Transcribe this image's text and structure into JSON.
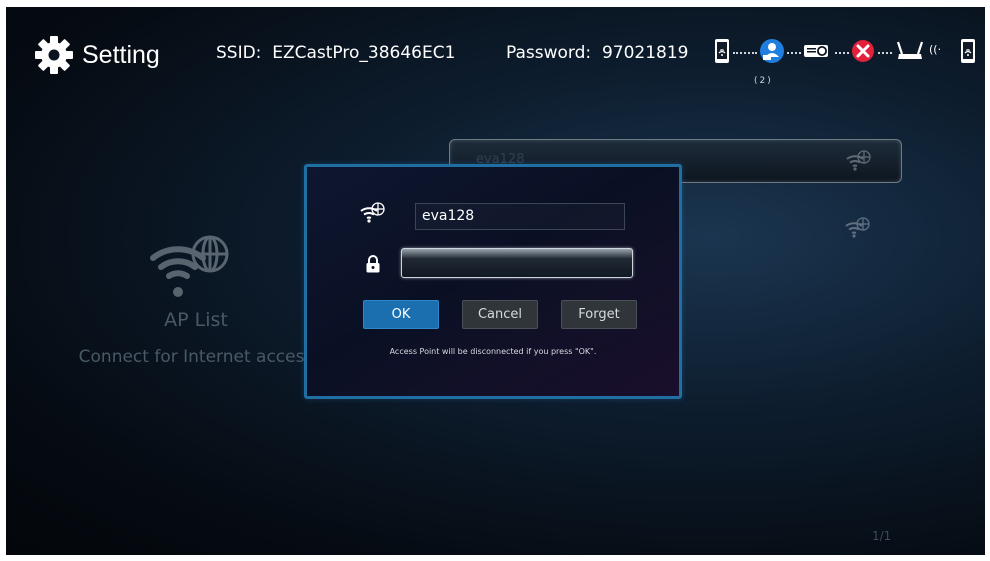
{
  "header": {
    "title": "Setting",
    "ssid_label": "SSID:",
    "ssid_value": "EZCastPro_38646EC1",
    "password_label": "Password:",
    "password_value": "97021819",
    "connection_count": "(2)"
  },
  "background": {
    "ap_title": "AP List",
    "ap_subtitle": "Connect for Internet access",
    "list": [
      {
        "name": "eva128",
        "selected": true
      },
      {
        "name": "",
        "selected": false
      }
    ],
    "pager": "1/1"
  },
  "dialog": {
    "ssid_value": "eva128",
    "password_value": "",
    "buttons": {
      "ok": "OK",
      "cancel": "Cancel",
      "forget": "Forget"
    },
    "warning": "Access Point will be disconnected if you press \"OK\"."
  },
  "icons": {
    "header": "gear-icon",
    "chain": [
      "phone-icon",
      "users-icon",
      "projector-icon",
      "error-icon",
      "router-icon",
      "phone-icon"
    ],
    "wifi": "wifi-globe-icon",
    "lock": "lock-icon"
  },
  "colors": {
    "accent": "#1b6fae",
    "dialog_border": "#1f6fa3",
    "error": "#e3213b"
  }
}
